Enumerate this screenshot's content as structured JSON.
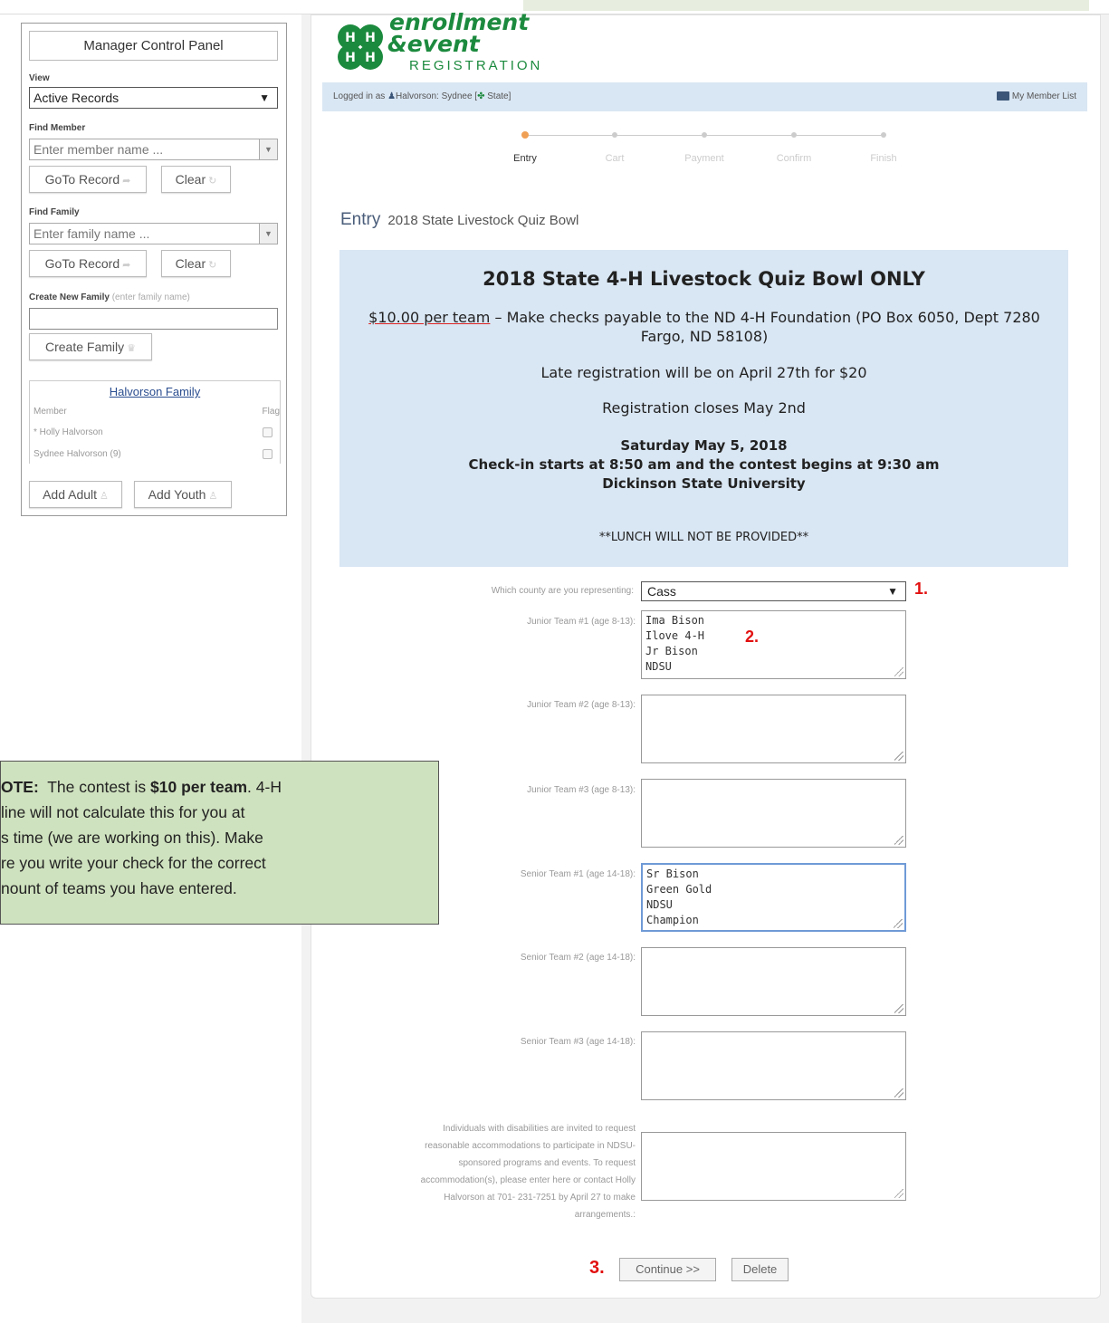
{
  "sidebar": {
    "title": "Manager Control Panel",
    "view_label": "View",
    "view_value": "Active Records",
    "find_member_label": "Find Member",
    "find_member_placeholder": "Enter member name ...",
    "goto_record": "GoTo Record",
    "clear": "Clear",
    "find_family_label": "Find Family",
    "find_family_placeholder": "Enter family name ...",
    "create_family_label": "Create New Family",
    "create_family_hint": "(enter family name)",
    "create_family_button": "Create Family",
    "family_title": "Halvorson Family",
    "member_header": "Member",
    "flag_header": "Flag",
    "members": [
      "* Holly Halvorson",
      "Sydnee Halvorson (9)"
    ],
    "add_adult": "Add Adult",
    "add_youth": "Add Youth"
  },
  "logo": {
    "line1": "enrollment",
    "line2": "&event",
    "line3": "REGISTRATION"
  },
  "loginbar": {
    "logged_in": "Logged in as",
    "user": "Halvorson: Sydnee [",
    "state": "State]",
    "member_list": "My Member List"
  },
  "steps": [
    "Entry",
    "Cart",
    "Payment",
    "Confirm",
    "Finish"
  ],
  "entry": {
    "heading": "Entry",
    "event_name": "2018 State Livestock Quiz Bowl"
  },
  "info": {
    "title": "2018 State 4-H Livestock Quiz Bowl ONLY",
    "price": "$10.00 per team",
    "price_rest": " – Make checks payable to the ND 4-H Foundation (PO Box 6050, Dept 7280 Fargo, ND 58108)",
    "late": "Late registration will be on April 27th for $20",
    "closes": "Registration closes May 2nd",
    "date": "Saturday May 5, 2018",
    "checkin": "Check-in starts at 8:50 am and the contest begins at 9:30 am",
    "location": "Dickinson State University",
    "lunch": "**LUNCH WILL NOT BE PROVIDED**"
  },
  "form": {
    "county_label": "Which county are you representing:",
    "county_value": "Cass",
    "jr1_label": "Junior Team #1 (age 8-13):",
    "jr1_value": "Ima Bison\nIlove 4-H\nJr Bison\nNDSU",
    "jr2_label": "Junior Team #2 (age 8-13):",
    "jr3_label": "Junior Team #3 (age 8-13):",
    "sr1_label": "Senior Team #1 (age 14-18):",
    "sr1_value": "Sr Bison\nGreen Gold\nNDSU\nChampion",
    "sr2_label": "Senior Team #2 (age 14-18):",
    "sr3_label": "Senior Team #3 (age 14-18):",
    "accom_lines": [
      "Individuals with disabilities are invited to request",
      "reasonable accommodations to participate in NDSU-",
      "sponsored programs and events. To request",
      "accommodation(s), please enter here or contact Holly",
      "Halvorson at 701- 231-7251 by April 27 to make",
      "arrangements.:"
    ],
    "continue": "Continue >>",
    "delete": "Delete"
  },
  "annotations": {
    "a1": "1.",
    "a2": "2.",
    "a3": "3."
  },
  "note": {
    "l1a": "OTE:",
    "l1b": "  The contest is ",
    "l1c": "$10 per team",
    "l1d": ". 4-H",
    "l2": "line will not calculate this for you at",
    "l3": "s time (we are working on this). Make",
    "l4": "re you write your check for the correct",
    "l5": "nount of teams you have entered."
  },
  "colors": {
    "accent_blue": "#d9e6f3",
    "annotation_red": "#e21010",
    "note_green": "#cfe2bf",
    "brand_green": "#1c8a3e"
  }
}
